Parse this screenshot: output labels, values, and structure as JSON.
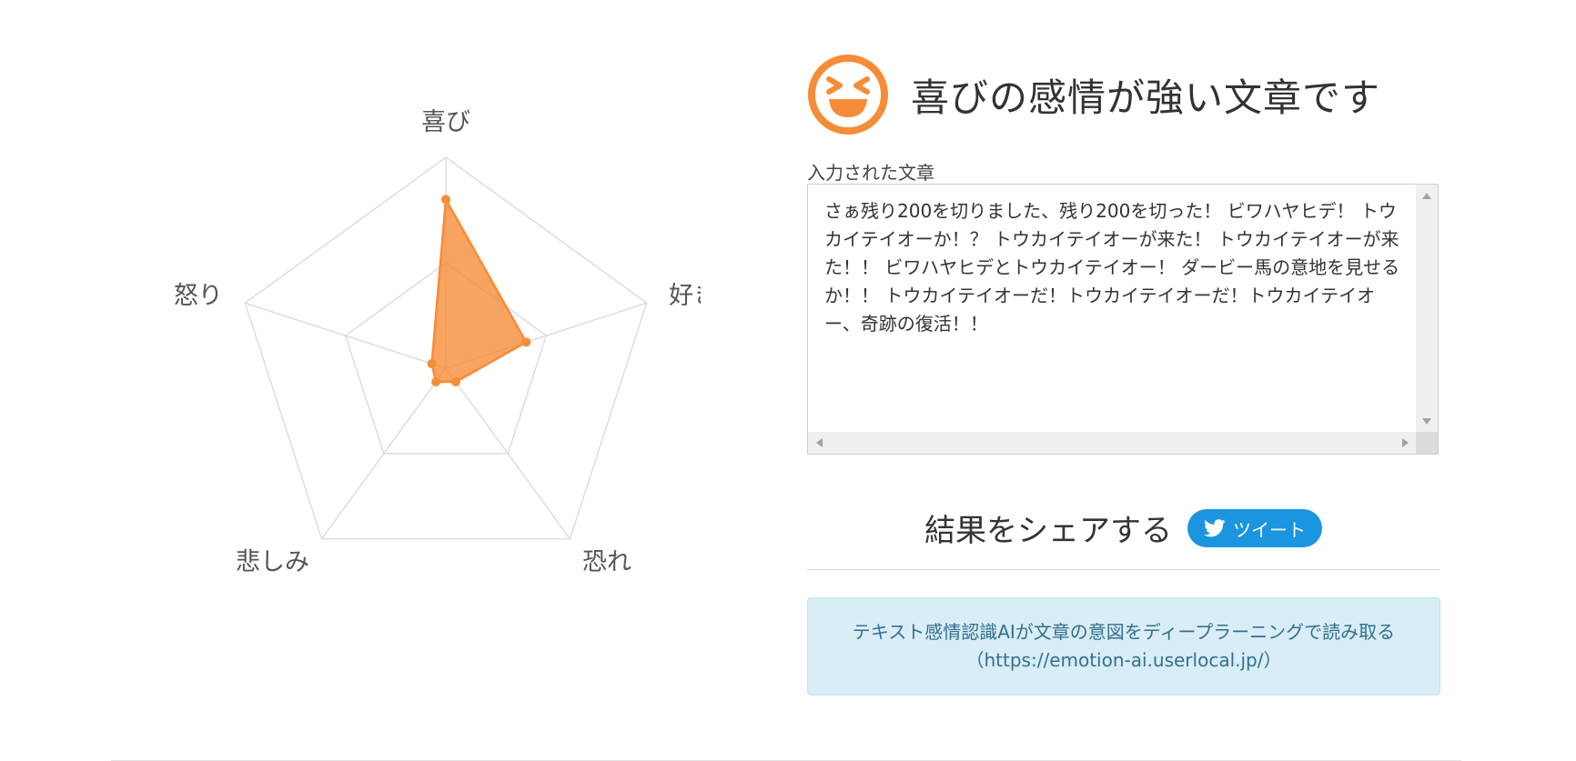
{
  "result": {
    "headline": "喜びの感情が強い文章です",
    "emoji_icon": "laughing-face-icon",
    "accent_color": "#f68c37"
  },
  "input": {
    "label": "入力された文章",
    "text": "さぁ残り200を切りました、残り200を切った！ ビワハヤヒデ！ トウカイテイオーか！？ トウカイテイオーが来た！ トウカイテイオーが来た！！ ビワハヤヒデとトウカイテイオー！ ダービー馬の意地を見せるか！！ トウカイテイオーだ！トウカイテイオーだ！トウカイテイオー、奇跡の復活！！"
  },
  "share": {
    "title": "結果をシェアする",
    "tweet_label": "ツイート",
    "tweet_icon": "twitter-bird-icon",
    "tweet_color": "#1b95e0"
  },
  "info": {
    "line1": "テキスト感情認識AIが文章の意図をディープラーニングで読み取る",
    "line2": "（https://emotion-ai.userlocal.jp/）"
  },
  "chart_data": {
    "type": "radar",
    "axes": [
      "喜び",
      "好き",
      "恐れ",
      "悲しみ",
      "怒り"
    ],
    "values": [
      0.8,
      0.4,
      0.08,
      0.08,
      0.07
    ],
    "range": [
      0,
      1
    ],
    "grid_levels": 2,
    "fill_color": "#f68c37",
    "grid_color": "#dddddd"
  }
}
